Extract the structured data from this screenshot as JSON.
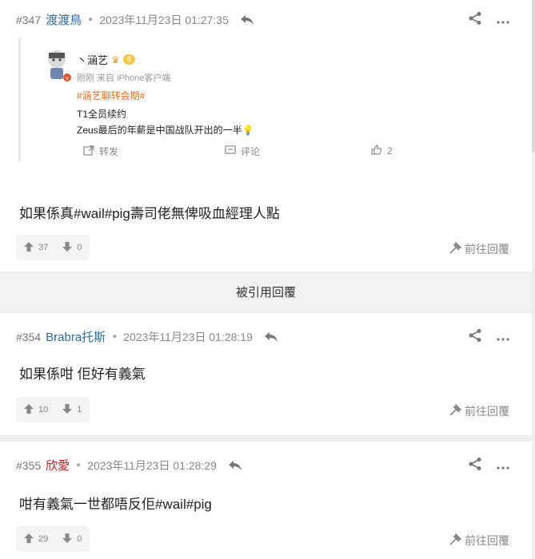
{
  "posts": [
    {
      "num": "#347",
      "user": "渡渡鳥",
      "time": "2023年11月23日 01:27:35",
      "content": "如果係真#wail#pig壽司佬無俾吸血經理人點",
      "up": "37",
      "down": "0",
      "reply_label": "前往回覆",
      "quote": {
        "name": "丶涵艺",
        "badge": "8",
        "sub": "刚刚 来自 iPhone客户端",
        "tag": "#涵艺聊转会期#",
        "line1": "T1全员续约",
        "line2": "Zeus最后的年薪是中国战队开出的一半",
        "repost": "转发",
        "comment": "评论",
        "likes": "2"
      }
    },
    {
      "num": "#354",
      "user": "Brabra托斯",
      "time": "2023年11月23日 01:28:19",
      "content": "如果係咁 佢好有義氣",
      "up": "10",
      "down": "1",
      "reply_label": "前往回覆"
    },
    {
      "num": "#355",
      "user": "欣愛",
      "time": "2023年11月23日 01:28:29",
      "content": "咁有義氣一世都唔反佢#wail#pig",
      "up": "29",
      "down": "0",
      "reply_label": "前往回覆"
    }
  ],
  "banner": "被引用回覆",
  "icons": [
    "reply-icon",
    "share-icon",
    "more-icon",
    "thumb-up-icon",
    "thumb-down-icon",
    "repost-icon",
    "comment-icon",
    "like-icon",
    "goto-reply-icon",
    "bulb-emoji"
  ],
  "colors": {
    "blue_user": "#2d6a9b",
    "red_user": "#b52020",
    "weibo_tag": "#e86a1e"
  }
}
